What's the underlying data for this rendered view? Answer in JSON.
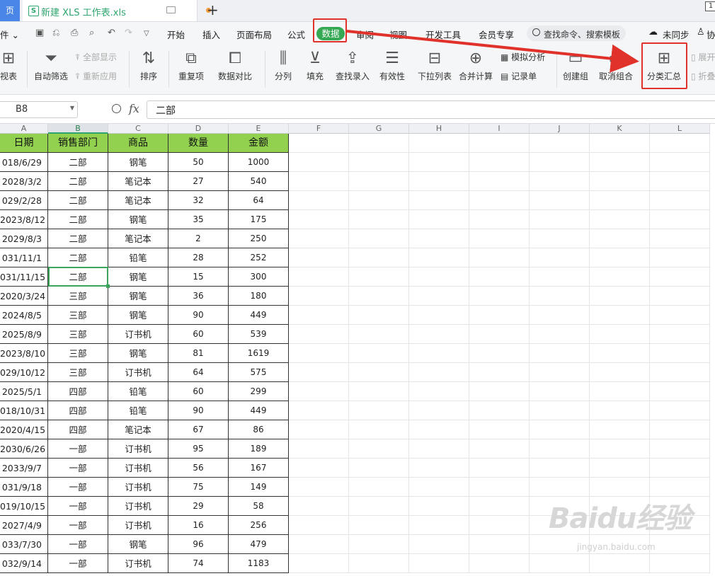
{
  "tabs": {
    "first": "页",
    "doc_title": "新建 XLS 工作表.xls",
    "plus": "+",
    "corner": "1"
  },
  "menu": {
    "file": "件 ⌄",
    "items": [
      "开始",
      "插入",
      "页面布局",
      "公式",
      "数据",
      "审阅",
      "视图",
      "开发工具",
      "会员专享"
    ],
    "search": "查找命令、搜索模板",
    "sync": "未同步",
    "collab": "协"
  },
  "ribbon": {
    "pivot": "视表",
    "autofilter": "自动筛选",
    "show_all": "全部显示",
    "reapply": "重新应用",
    "sort": "排序",
    "duplicates": "重复项",
    "compare": "数据对比",
    "split": "分列",
    "fill": "填充",
    "lookup": "查找录入",
    "validity": "有效性",
    "dropdown": "下拉列表",
    "consolidate": "合并计算",
    "whatif": "模拟分析",
    "record": "记录单",
    "group": "创建组",
    "ungroup": "取消组合",
    "subtotal": "分类汇总",
    "expand": "展开",
    "collapse": "折叠"
  },
  "formula_bar": {
    "cell_ref": "B8",
    "fx": "fx",
    "value": "二部"
  },
  "columns": [
    "A",
    "B",
    "C",
    "D",
    "E",
    "F",
    "G",
    "H",
    "I",
    "J",
    "K",
    "L"
  ],
  "table": {
    "headers": [
      "日期",
      "销售部门",
      "商品",
      "数量",
      "金额"
    ],
    "rows": [
      [
        "018/6/29",
        "二部",
        "钢笔",
        "50",
        "1000"
      ],
      [
        "2028/3/2",
        "二部",
        "笔记本",
        "27",
        "540"
      ],
      [
        "029/2/28",
        "二部",
        "笔记本",
        "32",
        "64"
      ],
      [
        "2023/8/12",
        "二部",
        "钢笔",
        "35",
        "175"
      ],
      [
        "2029/8/3",
        "二部",
        "笔记本",
        "2",
        "250"
      ],
      [
        "031/11/1",
        "二部",
        "铅笔",
        "28",
        "252"
      ],
      [
        "031/11/15",
        "二部",
        "钢笔",
        "15",
        "300"
      ],
      [
        "2020/3/24",
        "三部",
        "钢笔",
        "36",
        "180"
      ],
      [
        "2024/8/5",
        "三部",
        "钢笔",
        "90",
        "449"
      ],
      [
        "2025/8/9",
        "三部",
        "订书机",
        "60",
        "539"
      ],
      [
        "2023/8/10",
        "三部",
        "钢笔",
        "81",
        "1619"
      ],
      [
        "029/10/12",
        "三部",
        "订书机",
        "64",
        "575"
      ],
      [
        "2025/5/1",
        "四部",
        "铅笔",
        "60",
        "299"
      ],
      [
        "018/10/31",
        "四部",
        "铅笔",
        "90",
        "449"
      ],
      [
        "2020/4/15",
        "四部",
        "笔记本",
        "67",
        "86"
      ],
      [
        "2030/6/26",
        "一部",
        "订书机",
        "95",
        "189"
      ],
      [
        "2033/9/7",
        "一部",
        "订书机",
        "56",
        "167"
      ],
      [
        "031/9/18",
        "一部",
        "订书机",
        "75",
        "149"
      ],
      [
        "019/10/15",
        "一部",
        "订书机",
        "29",
        "58"
      ],
      [
        "2027/4/9",
        "一部",
        "订书机",
        "16",
        "256"
      ],
      [
        "033/7/30",
        "一部",
        "钢笔",
        "96",
        "479"
      ],
      [
        "032/9/14",
        "一部",
        "订书机",
        "74",
        "1183"
      ]
    ]
  },
  "watermark": {
    "logo": "Baidu经验",
    "url": "jingyan.baidu.com"
  },
  "colors": {
    "accent_green": "#34a853",
    "header_fill": "#92d050",
    "highlight_red": "#e0312a"
  }
}
